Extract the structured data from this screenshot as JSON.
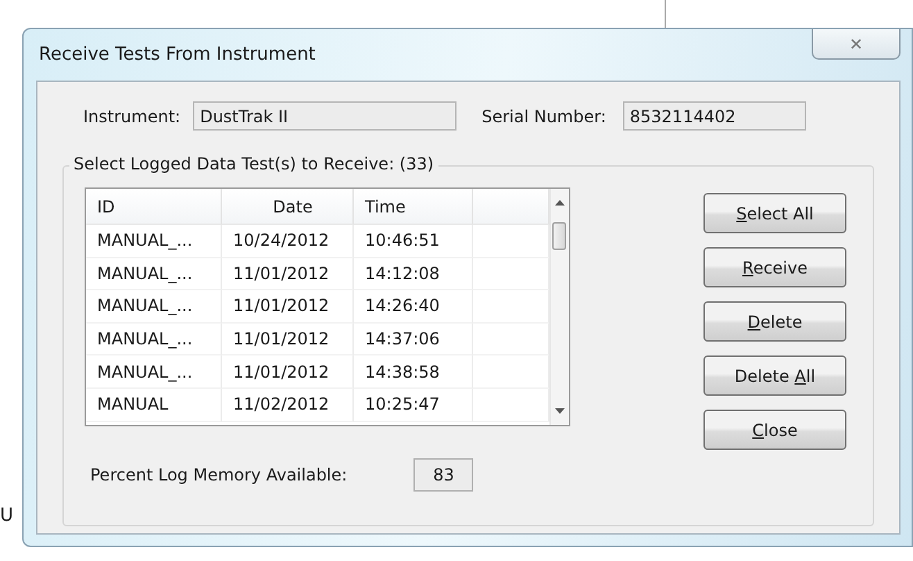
{
  "background": {
    "fragment": "U"
  },
  "window": {
    "title": "Receive Tests From Instrument",
    "close": "✕"
  },
  "instrument": {
    "label": "Instrument:",
    "value": "DustTrak II"
  },
  "serial": {
    "label": "Serial Number:",
    "value": "8532114402"
  },
  "group": {
    "legend": "Select Logged Data Test(s) to Receive: (33)"
  },
  "table": {
    "columns": [
      "ID",
      "Date",
      "Time"
    ],
    "rows": [
      {
        "cells": [
          "MANUAL_...",
          "10/24/2012",
          "10:46:51"
        ]
      },
      {
        "cells": [
          "MANUAL_...",
          "11/01/2012",
          "14:12:08"
        ]
      },
      {
        "cells": [
          "MANUAL_...",
          "11/01/2012",
          "14:26:40"
        ]
      },
      {
        "cells": [
          "MANUAL_...",
          "11/01/2012",
          "14:37:06"
        ]
      },
      {
        "cells": [
          "MANUAL_...",
          "11/01/2012",
          "14:38:58"
        ]
      },
      {
        "cells": [
          "MANUAL",
          "11/02/2012",
          "10:25:47"
        ]
      }
    ]
  },
  "buttons": [
    {
      "key": "S",
      "after": "elect All"
    },
    {
      "key": "R",
      "after": "eceive"
    },
    {
      "key": "D",
      "after": "elete"
    },
    {
      "before": "Delete ",
      "key": "A",
      "after": "ll"
    },
    {
      "key": "C",
      "after": "lose"
    }
  ],
  "memory": {
    "label": "Percent Log Memory Available:",
    "value": "83"
  }
}
